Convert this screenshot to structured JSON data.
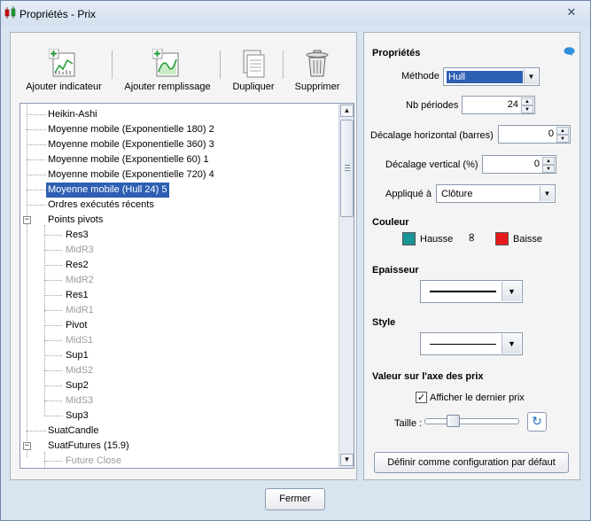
{
  "window": {
    "title": "Propriétés - Prix"
  },
  "toolbar": {
    "add_indicator": "Ajouter indicateur",
    "add_fill": "Ajouter remplissage",
    "duplicate": "Dupliquer",
    "delete": "Supprimer"
  },
  "tree": {
    "items": [
      {
        "label": "Heikin-Ashi"
      },
      {
        "label": "Moyenne mobile (Exponentielle 180) 2"
      },
      {
        "label": "Moyenne mobile (Exponentielle 360) 3"
      },
      {
        "label": "Moyenne mobile (Exponentielle 60) 1"
      },
      {
        "label": "Moyenne mobile (Exponentielle 720) 4"
      },
      {
        "label": "Moyenne mobile (Hull 24) 5"
      },
      {
        "label": "Ordres exécutés récents"
      },
      {
        "label": "Points pivots"
      },
      {
        "label": "Res3"
      },
      {
        "label": "MidR3"
      },
      {
        "label": "Res2"
      },
      {
        "label": "MidR2"
      },
      {
        "label": "Res1"
      },
      {
        "label": "MidR1"
      },
      {
        "label": "Pivot"
      },
      {
        "label": "MidS1"
      },
      {
        "label": "Sup1"
      },
      {
        "label": "MidS2"
      },
      {
        "label": "Sup2"
      },
      {
        "label": "MidS3"
      },
      {
        "label": "Sup3"
      },
      {
        "label": "SuatCandle"
      },
      {
        "label": "SuatFutures (15.9)"
      },
      {
        "label": "Future Close"
      }
    ],
    "toggle_expanded": "−"
  },
  "properties": {
    "heading": "Propriétés",
    "method_label": "Méthode",
    "method_value": "Hull",
    "periods_label": "Nb périodes",
    "periods_value": "24",
    "hshift_label": "Décalage horizontal (barres)",
    "hshift_value": "0",
    "vshift_label": "Décalage vertical (%)",
    "vshift_value": "0",
    "applied_label": "Appliqué à",
    "applied_value": "Clôture",
    "color_heading": "Couleur",
    "rise_label": "Hausse",
    "rise_color": "#1a9496",
    "fall_label": "Baisse",
    "fall_color": "#e8181b",
    "thickness_heading": "Epaisseur",
    "style_heading": "Style",
    "axis_heading": "Valeur sur l'axe des prix",
    "show_last_price_label": "Afficher le dernier prix",
    "show_last_price_checked": "✓",
    "size_label": "Taille :",
    "default_button": "Définir comme configuration par défaut"
  },
  "footer": {
    "close_button": "Fermer"
  },
  "icons": {
    "close": "✕",
    "scroll_up": "▲",
    "scroll_down": "▼",
    "dropdown": "▼",
    "spin_up": "▲",
    "spin_down": "▼",
    "reset": "↻",
    "link": "∞"
  }
}
